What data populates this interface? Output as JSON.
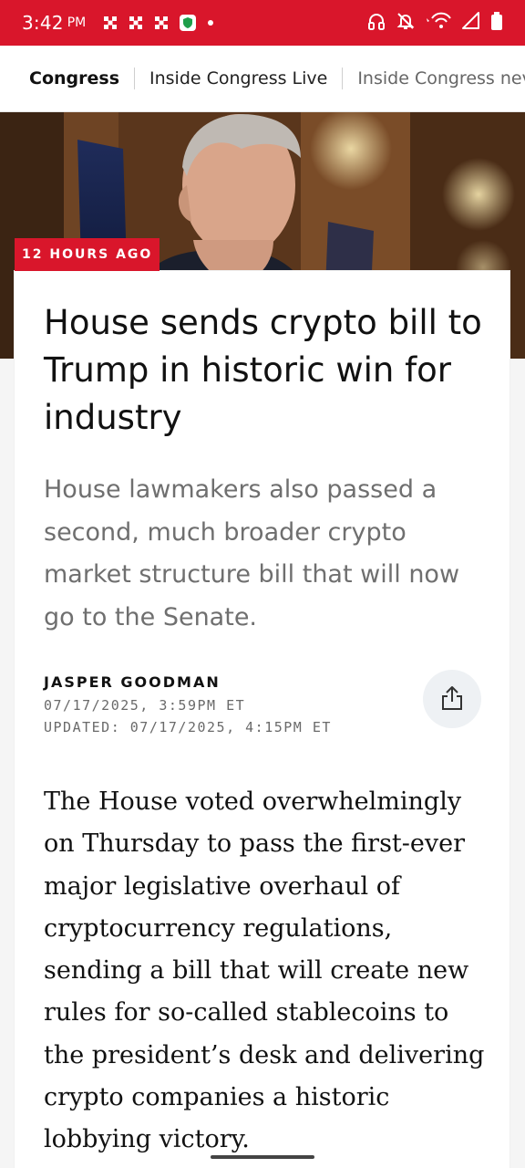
{
  "status_bar": {
    "time": "3:42",
    "ampm": "PM",
    "background": "#d9162b",
    "notification_icons": [
      "network-x-icon",
      "network-x-icon",
      "network-x-icon",
      "shield-app-icon",
      "dot-icon"
    ],
    "system_icons": [
      "headphones-icon",
      "bell-off-icon",
      "wifi-icon",
      "signal-icon",
      "battery-icon"
    ]
  },
  "nav": {
    "tabs": [
      {
        "label": "Congress",
        "active": true
      },
      {
        "label": "Inside Congress Live",
        "active": false
      },
      {
        "label": "Inside Congress nev",
        "active": false
      }
    ]
  },
  "article": {
    "time_badge": "12 HOURS AGO",
    "headline": "House sends crypto bill to Trump in historic win for industry",
    "dek": "House lawmakers also passed a second, much broader crypto market structure bill that will now go to the Senate.",
    "author": "JASPER GOODMAN",
    "published": "07/17/2025, 3:59PM ET",
    "updated": "UPDATED: 07/17/2025, 4:15PM ET",
    "share_icon": "share-icon",
    "body": "The House voted overwhelmingly on Thursday to pass the first-ever major legislative overhaul of cryptocurrency regulations, sending a bill that will create new rules for so-called stablecoins to the president’s desk and delivering crypto companies a historic lobbying victory."
  },
  "colors": {
    "accent": "#d9162b",
    "text": "#111111",
    "muted": "#6f6f6f"
  }
}
